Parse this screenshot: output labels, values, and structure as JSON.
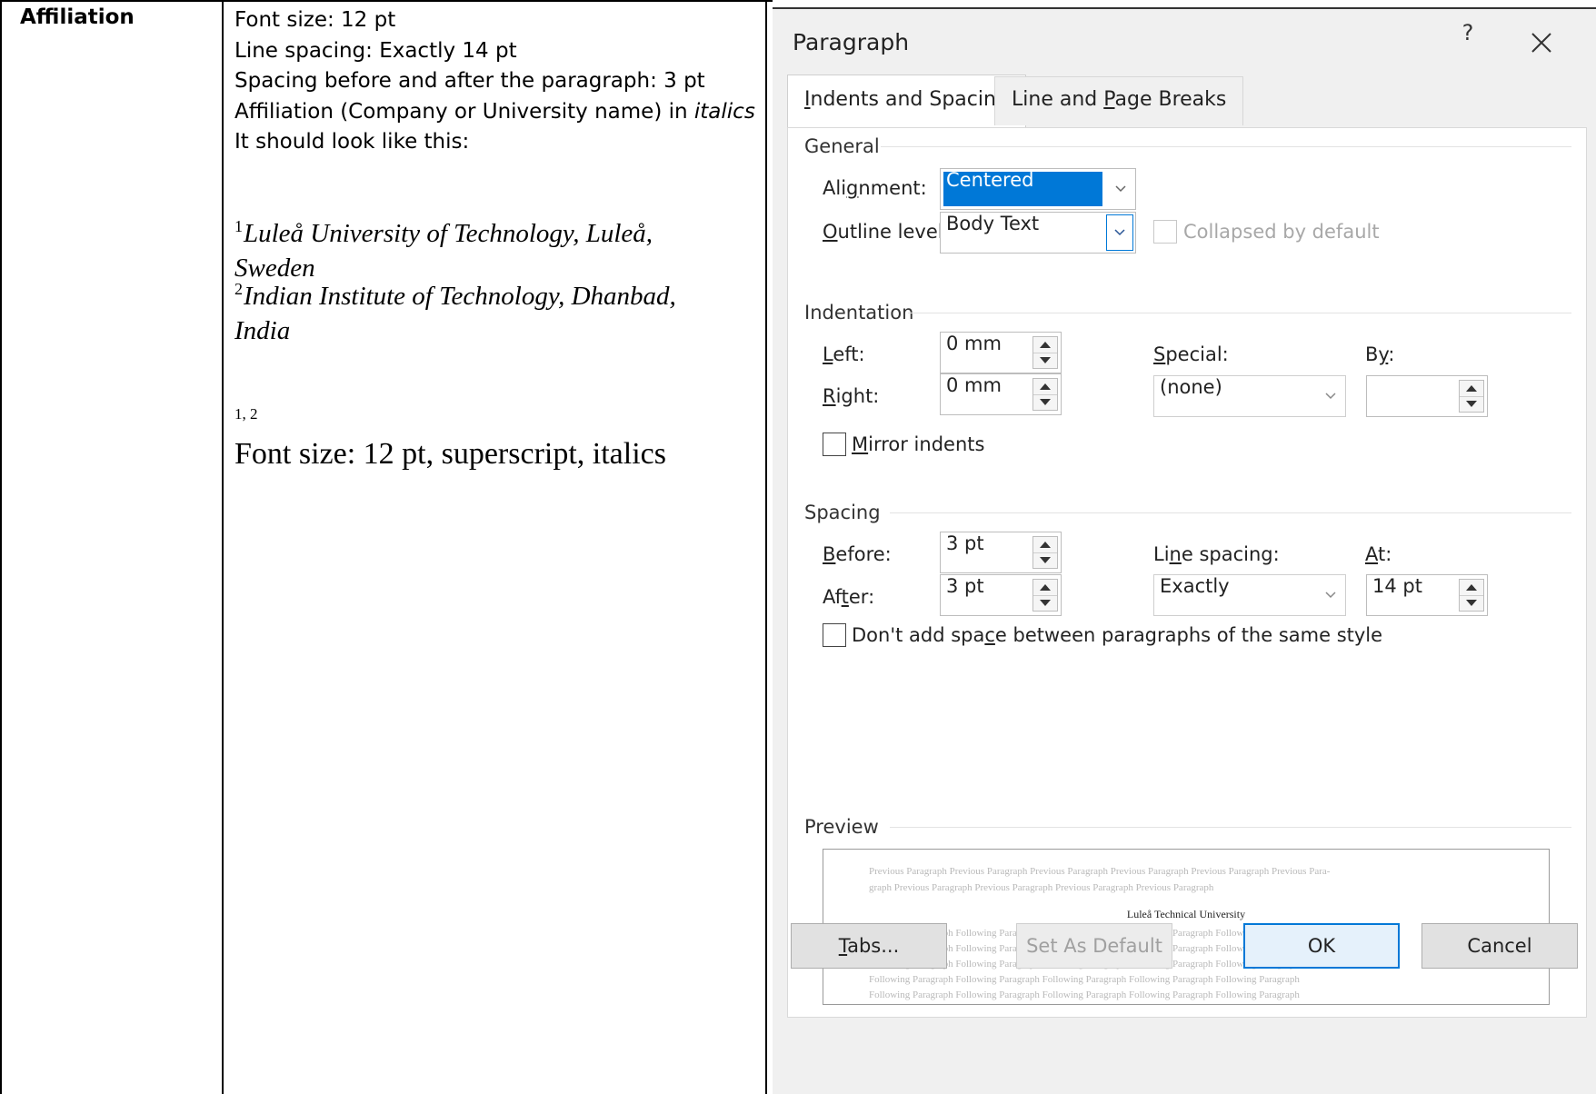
{
  "document": {
    "label": "Affiliation",
    "instructions": [
      "Font size: 12 pt",
      "Line spacing: Exactly 14 pt",
      "Spacing before and after the paragraph: 3 pt",
      "Affiliation (Company or University name) in ",
      "italics",
      "It should look like this:"
    ],
    "example": {
      "line1_sup": "1",
      "line1_text": "Luleå University of Technology, Luleå,",
      "line1_cont": "Sweden",
      "line2_sup": "2",
      "line2_text": "Indian Institute of Technology, Dhanbad,",
      "line2_cont": "India"
    },
    "superscript_note": "1, 2",
    "format_note": "Font size: 12 pt, superscript, italics"
  },
  "dialog": {
    "title": "Paragraph",
    "help_label": "?",
    "tabs": [
      {
        "label_pre": "",
        "label_u": "I",
        "label_post": "ndents and Spacing",
        "active": true
      },
      {
        "label_pre": "Line and ",
        "label_u": "P",
        "label_post": "age Breaks",
        "active": false
      }
    ],
    "general": {
      "heading": "General",
      "alignment_label_pre": "Ali",
      "alignment_label_u": "g",
      "alignment_label_post": "nment:",
      "alignment_value": "Centered",
      "outline_label_u": "O",
      "outline_label_post": "utline level:",
      "outline_value": "Body Text",
      "collapsed_label": "Collapsed by default"
    },
    "indentation": {
      "heading": "Indentation",
      "left_label_u": "L",
      "left_label_post": "eft:",
      "left_value": "0 mm",
      "right_label_u": "R",
      "right_label_post": "ight:",
      "right_value": "0 mm",
      "special_label_u": "S",
      "special_label_post": "pecial:",
      "special_value": "(none)",
      "by_label_pre": "B",
      "by_label_u": "y",
      "by_label_post": ":",
      "by_value": "",
      "mirror_label_u": "M",
      "mirror_label_post": "irror indents"
    },
    "spacing": {
      "heading": "Spacing",
      "before_label_u": "B",
      "before_label_post": "efore:",
      "before_value": "3 pt",
      "after_label_pre": "Af",
      "after_label_u": "t",
      "after_label_post": "er:",
      "after_value": "3 pt",
      "line_label_pre": "Li",
      "line_label_u": "n",
      "line_label_post": "e spacing:",
      "line_value": "Exactly",
      "at_label_u": "A",
      "at_label_post": "t:",
      "at_value": "14 pt",
      "dont_add_pre": "Don't add spa",
      "dont_add_u": "c",
      "dont_add_post": "e between paragraphs of the same style"
    },
    "preview": {
      "heading": "Preview",
      "previous_line1": "Previous Paragraph Previous Paragraph Previous Paragraph Previous Paragraph Previous Paragraph Previous Para-",
      "previous_line2": "graph Previous Paragraph Previous Paragraph Previous Paragraph Previous Paragraph",
      "main_text": "Luleå Technical University",
      "following_line": "Following Paragraph Following Paragraph Following Paragraph Following Paragraph Following Paragraph"
    },
    "buttons": {
      "tabs_u": "T",
      "tabs_post": "abs...",
      "set_default": "Set As Default",
      "ok": "OK",
      "cancel": "Cancel"
    },
    "colors": {
      "accent": "#0078d7",
      "dialog_bg": "#f0f0f0"
    }
  }
}
